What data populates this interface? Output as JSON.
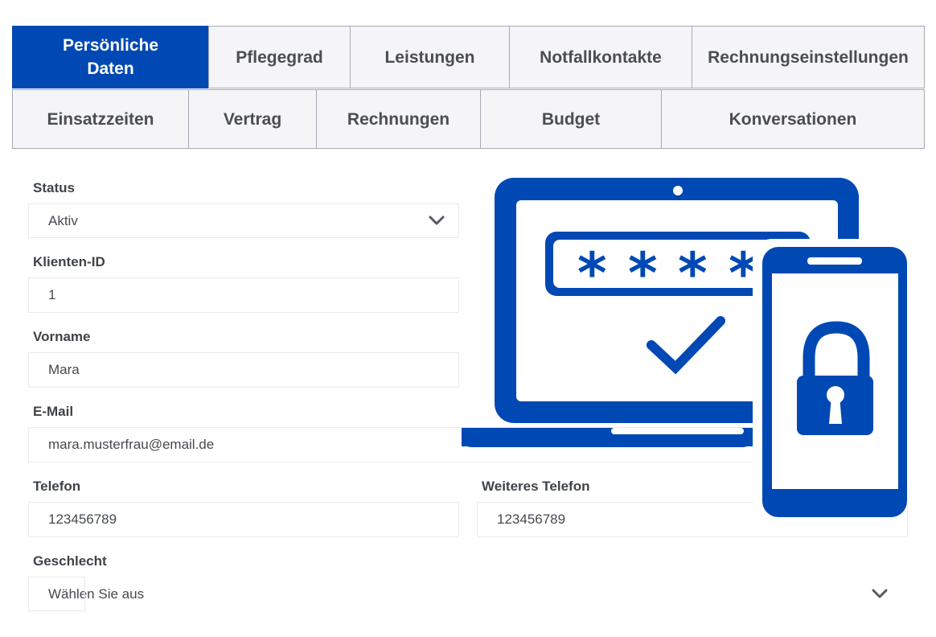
{
  "tabs": {
    "row1": [
      {
        "label": "Persönliche Daten",
        "active": true
      },
      {
        "label": "Pflegegrad"
      },
      {
        "label": "Leistungen"
      },
      {
        "label": "Notfallkontakte"
      },
      {
        "label": "Rechnungseinstellungen"
      }
    ],
    "row2": [
      {
        "label": "Einsatzzeiten"
      },
      {
        "label": "Vertrag"
      },
      {
        "label": "Rechnungen"
      },
      {
        "label": "Budget"
      },
      {
        "label": "Konversationen"
      }
    ]
  },
  "form": {
    "status": {
      "label": "Status",
      "value": "Aktiv"
    },
    "client_id": {
      "label": "Klienten-ID",
      "value": "1"
    },
    "first_name": {
      "label": "Vorname",
      "value": "Mara"
    },
    "email": {
      "label": "E-Mail",
      "value": "mara.musterfrau@email.de"
    },
    "phone": {
      "label": "Telefon",
      "value": "123456789"
    },
    "phone2": {
      "label": "Weiteres Telefon",
      "value": "123456789"
    },
    "gender": {
      "label": "Geschlecht",
      "value": "Wählen Sie aus"
    }
  },
  "icons": {
    "status_chevron": "chevron-down-icon",
    "gender_chevron": "chevron-down-icon",
    "illustration": "secure-login-illustration"
  },
  "colors": {
    "brand": "#0048b3",
    "tab_bg": "#f5f5f7",
    "tab_border": "#a9a9b5"
  }
}
